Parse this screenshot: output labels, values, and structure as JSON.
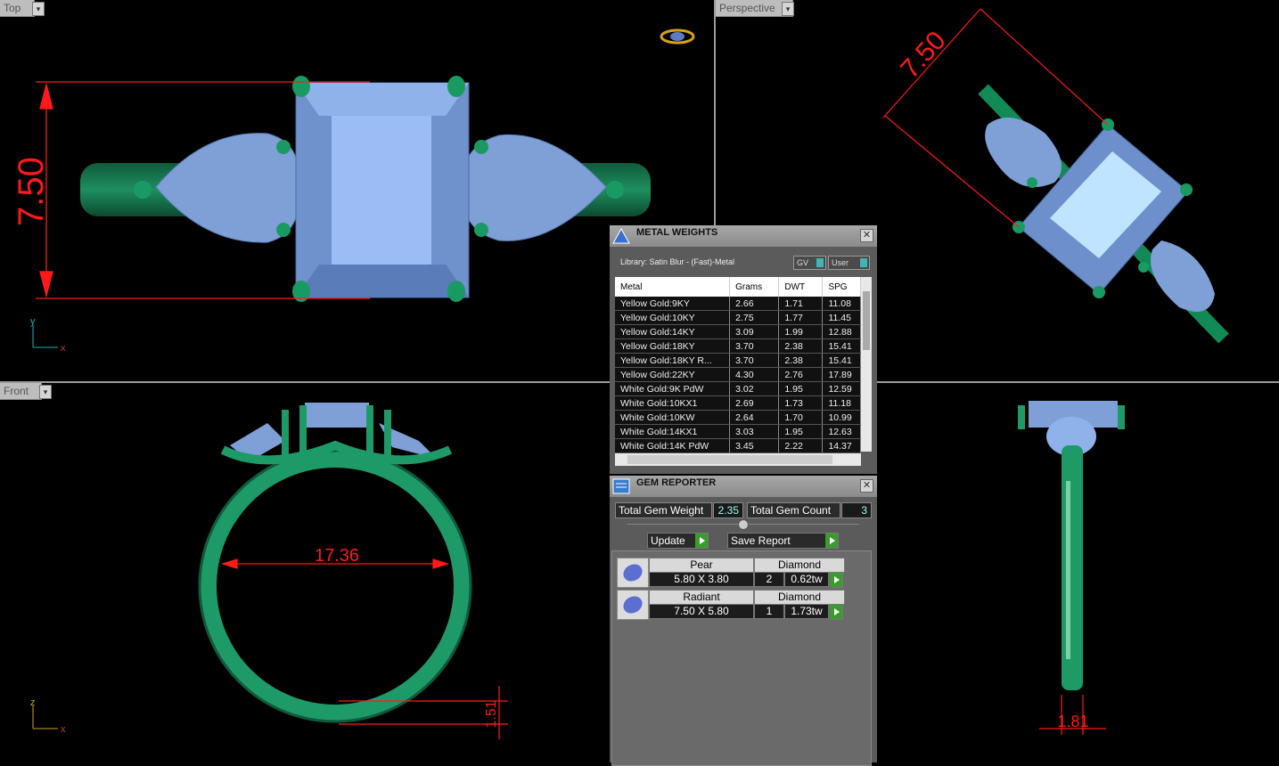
{
  "viewports": {
    "top": {
      "label": "Top",
      "dimension": "7.50",
      "axis_v": "y",
      "axis_h": "x"
    },
    "perspective": {
      "label": "Perspective",
      "dimension": "7.50"
    },
    "front": {
      "label": "Front",
      "dimension_inner": "17.36",
      "dimension_band": "1.51",
      "axis_v": "z",
      "axis_h": "x"
    },
    "right": {
      "dimension": "1.81"
    }
  },
  "metal_weights": {
    "title": "METAL WEIGHTS",
    "library": "Library: Satin Blur - (Fast)-Metal",
    "toggle_gv": "GV",
    "toggle_user": "User",
    "columns": [
      "Metal",
      "Grams",
      "DWT",
      "SPG"
    ],
    "rows": [
      [
        "Yellow Gold:9KY",
        "2.66",
        "1.71",
        "11.08"
      ],
      [
        "Yellow Gold:10KY",
        "2.75",
        "1.77",
        "11.45"
      ],
      [
        "Yellow Gold:14KY",
        "3.09",
        "1.99",
        "12.88"
      ],
      [
        "Yellow Gold:18KY",
        "3.70",
        "2.38",
        "15.41"
      ],
      [
        "Yellow Gold:18KY R...",
        "3.70",
        "2.38",
        "15.41"
      ],
      [
        "Yellow Gold:22KY",
        "4.30",
        "2.76",
        "17.89"
      ],
      [
        "White Gold:9K PdW",
        "3.02",
        "1.95",
        "12.59"
      ],
      [
        "White Gold:10KX1",
        "2.69",
        "1.73",
        "11.18"
      ],
      [
        "White Gold:10KW",
        "2.64",
        "1.70",
        "10.99"
      ],
      [
        "White Gold:14KX1",
        "3.03",
        "1.95",
        "12.63"
      ],
      [
        "White Gold:14K PdW",
        "3.45",
        "2.22",
        "14.37"
      ]
    ]
  },
  "gem_reporter": {
    "title": "GEM REPORTER",
    "total_weight_label": "Total Gem Weight",
    "total_weight": "2.35",
    "total_count_label": "Total Gem Count",
    "total_count": "3",
    "update_label": "Update",
    "save_label": "Save Report",
    "gems": [
      {
        "shape": "Pear",
        "type": "Diamond",
        "size": "5.80 X 3.80",
        "count": "2",
        "weight": "0.62tw"
      },
      {
        "shape": "Radiant",
        "type": "Diamond",
        "size": "7.50 X 5.80",
        "count": "1",
        "weight": "1.73tw"
      }
    ]
  },
  "colors": {
    "metal": "#1f8a5f",
    "gem": "#7fa3dd",
    "dimension": "#ff1a1a",
    "prong": "#17804f"
  }
}
